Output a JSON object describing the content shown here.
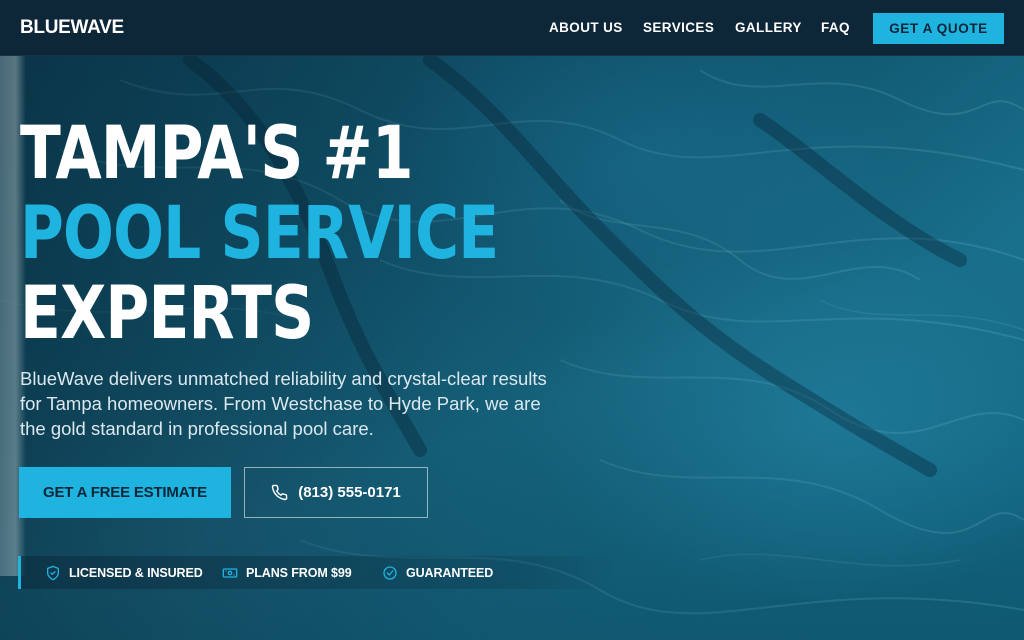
{
  "brand": {
    "logo_text": "BLUEWAVE"
  },
  "nav": {
    "items": [
      {
        "label": "ABOUT US"
      },
      {
        "label": "SERVICES"
      },
      {
        "label": "GALLERY"
      },
      {
        "label": "FAQ"
      }
    ],
    "cta_label": "GET A QUOTE"
  },
  "hero": {
    "headline_line1": "TAMPA'S #1",
    "headline_line2": "POOL SERVICE",
    "headline_line3": "EXPERTS",
    "intro": "BlueWave delivers unmatched reliability and crystal-clear results for Tampa homeowners. From Westchase to Hyde Park, we are the gold standard in professional pool care.",
    "primary_cta": "GET A FREE ESTIMATE",
    "phone_cta": "(813) 555-0171"
  },
  "trust": {
    "items": [
      {
        "label": "LICENSED & INSURED",
        "icon": "shield-check-icon"
      },
      {
        "label": "PLANS FROM $99",
        "icon": "money-icon"
      },
      {
        "label": "GUARANTEED",
        "icon": "check-circle-icon"
      }
    ]
  },
  "colors": {
    "accent": "#1fb3e0",
    "nav_bg": "#0d2638",
    "text_light": "#ffffff"
  }
}
